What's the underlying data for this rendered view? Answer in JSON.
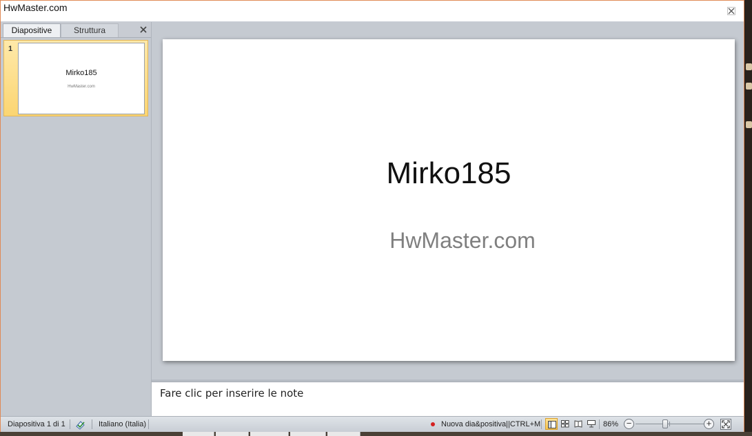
{
  "window": {
    "title": "HwMaster.com"
  },
  "panel": {
    "tabs": [
      {
        "label": "Diapositive",
        "active": true
      },
      {
        "label": "Struttura",
        "active": false
      }
    ]
  },
  "thumbnails": [
    {
      "number": "1",
      "title": "Mirko185",
      "subtitle": "HwMaster.com",
      "selected": true
    }
  ],
  "slide": {
    "title": "Mirko185",
    "subtitle": "HwMaster.com"
  },
  "notes": {
    "placeholder": "Fare clic per inserire le note"
  },
  "statusbar": {
    "slide_info": "Diapositiva 1 di 1",
    "language": "Italiano (Italia)",
    "hint": "Nuova dia&positiva||CTRL+M",
    "zoom": "86%",
    "zoom_fraction": 0.43
  },
  "colors": {
    "accent_border": "#e08a56",
    "selection": "#fbd572",
    "pane": "#c5cad1"
  },
  "icons": [
    "close-icon",
    "pane-close-icon",
    "spellcheck-icon",
    "normal-view-icon",
    "sorter-view-icon",
    "reading-view-icon",
    "slideshow-view-icon",
    "zoom-out-icon",
    "zoom-in-icon",
    "fit-window-icon"
  ]
}
